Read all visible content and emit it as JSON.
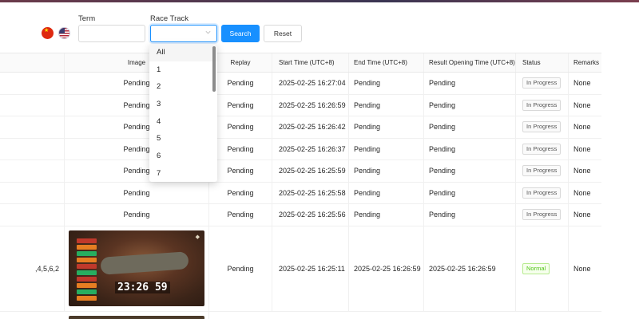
{
  "filters": {
    "term_label": "Term",
    "term_value": "",
    "race_track_label": "Race Track",
    "race_track_value": "",
    "search_label": "Search",
    "reset_label": "Reset"
  },
  "languages": [
    {
      "name": "chinese-flag-icon"
    },
    {
      "name": "us-flag-icon"
    }
  ],
  "dropdown": {
    "options": [
      "All",
      "1",
      "2",
      "3",
      "4",
      "5",
      "6",
      "7"
    ],
    "highlighted": "All"
  },
  "table": {
    "columns": [
      "",
      "Image",
      "Replay",
      "Start Time (UTC+8)",
      "End Time (UTC+8)",
      "Result Opening Time (UTC+8)",
      "Status",
      "Remarks"
    ],
    "rows": [
      {
        "result": "",
        "image": "Pending",
        "replay": "Pending",
        "start": "2025-02-25 16:27:04",
        "end": "Pending",
        "opening": "Pending",
        "status": "In Progress",
        "remarks": "None"
      },
      {
        "result": "",
        "image": "Pending",
        "replay": "Pending",
        "start": "2025-02-25 16:26:59",
        "end": "Pending",
        "opening": "Pending",
        "status": "In Progress",
        "remarks": "None"
      },
      {
        "result": "",
        "image": "Pending",
        "replay": "Pending",
        "start": "2025-02-25 16:26:42",
        "end": "Pending",
        "opening": "Pending",
        "status": "In Progress",
        "remarks": "None"
      },
      {
        "result": "",
        "image": "Pending",
        "replay": "Pending",
        "start": "2025-02-25 16:26:37",
        "end": "Pending",
        "opening": "Pending",
        "status": "In Progress",
        "remarks": "None"
      },
      {
        "result": "",
        "image": "Pending",
        "replay": "Pending",
        "start": "2025-02-25 16:25:59",
        "end": "Pending",
        "opening": "Pending",
        "status": "In Progress",
        "remarks": "None"
      },
      {
        "result": "",
        "image": "Pending",
        "replay": "Pending",
        "start": "2025-02-25 16:25:58",
        "end": "Pending",
        "opening": "Pending",
        "status": "In Progress",
        "remarks": "None"
      },
      {
        "result": "",
        "image": "Pending",
        "replay": "Pending",
        "start": "2025-02-25 16:25:56",
        "end": "Pending",
        "opening": "Pending",
        "status": "In Progress",
        "remarks": "None"
      },
      {
        "result": ",4,5,6,2",
        "image": "",
        "replay": "Pending",
        "start": "2025-02-25 16:25:11",
        "end": "2025-02-25 16:26:59",
        "opening": "2025-02-25 16:26:59",
        "status": "Normal",
        "remarks": "None",
        "thumb_timer": "23:26 59"
      }
    ]
  },
  "colors": {
    "primary": "#1890ff",
    "normal_green": "#52c41a",
    "header_bg": "#fafafa"
  }
}
